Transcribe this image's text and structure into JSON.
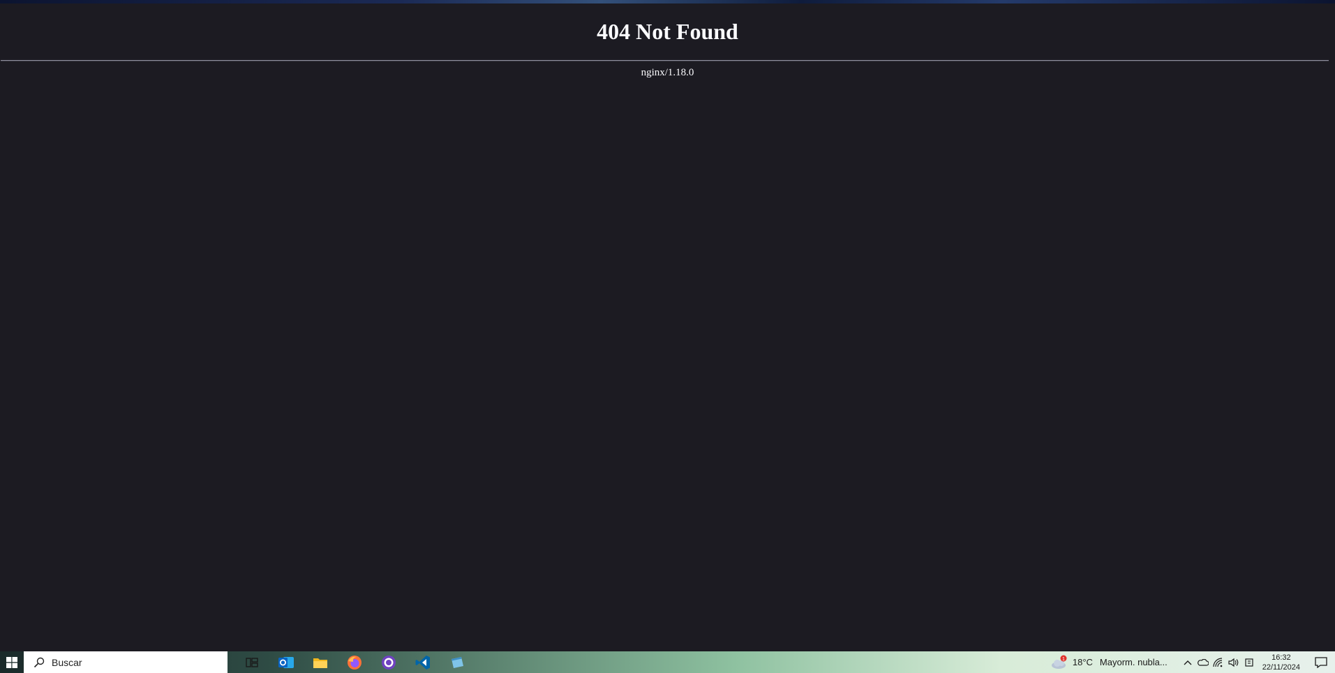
{
  "page": {
    "heading": "404 Not Found",
    "server": "nginx/1.18.0"
  },
  "taskbar": {
    "search_placeholder": "Buscar",
    "apps": [
      "task-view",
      "outlook",
      "file-explorer",
      "firefox",
      "github-desktop",
      "vscode",
      "notepad"
    ],
    "weather": {
      "temperature": "18°C",
      "condition": "Mayorm. nubla...",
      "alert_badge": "1"
    },
    "clock": {
      "time": "16:32",
      "date": "22/11/2024"
    }
  },
  "colors": {
    "page_background": "#1c1b22",
    "text": "#fbfbfe",
    "rule": "#8f8f9d"
  }
}
